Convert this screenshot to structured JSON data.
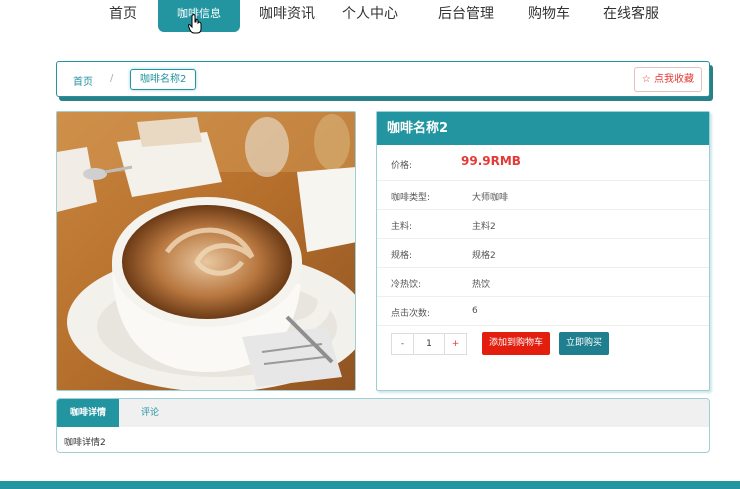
{
  "nav": {
    "items": [
      {
        "label": "首页"
      },
      {
        "label": "咖啡信息"
      },
      {
        "label": "咖啡资讯"
      },
      {
        "label": "个人中心"
      },
      {
        "label": "后台管理"
      },
      {
        "label": "购物车"
      },
      {
        "label": "在线客服"
      }
    ],
    "active_index": 1
  },
  "breadcrumb": {
    "home": "首页",
    "separator": "/",
    "current": "咖啡名称2"
  },
  "favorite_button": "☆ 点我收藏",
  "product": {
    "image_alt": "coffee cup photo",
    "title": "咖啡名称2",
    "price_label": "价格:",
    "price": "99.9RMB",
    "fields": [
      {
        "key": "咖啡类型:",
        "value": "大师咖啡"
      },
      {
        "key": "主料:",
        "value": "主料2"
      },
      {
        "key": "规格:",
        "value": "规格2"
      },
      {
        "key": "冷热饮:",
        "value": "热饮"
      },
      {
        "key": "点击次数:",
        "value": "6"
      }
    ],
    "quantity": {
      "minus": "-",
      "value": "1",
      "plus": "+"
    },
    "add_to_cart": "添加到购物车",
    "buy_now": "立即购买"
  },
  "tabs": {
    "items": [
      {
        "label": "咖啡详情"
      },
      {
        "label": "评论"
      }
    ],
    "content": "咖啡详情2"
  },
  "colors": {
    "accent": "#2295a0",
    "price": "#e53935",
    "cart_button": "#e31e0e",
    "buy_button": "#1f7f8e"
  }
}
